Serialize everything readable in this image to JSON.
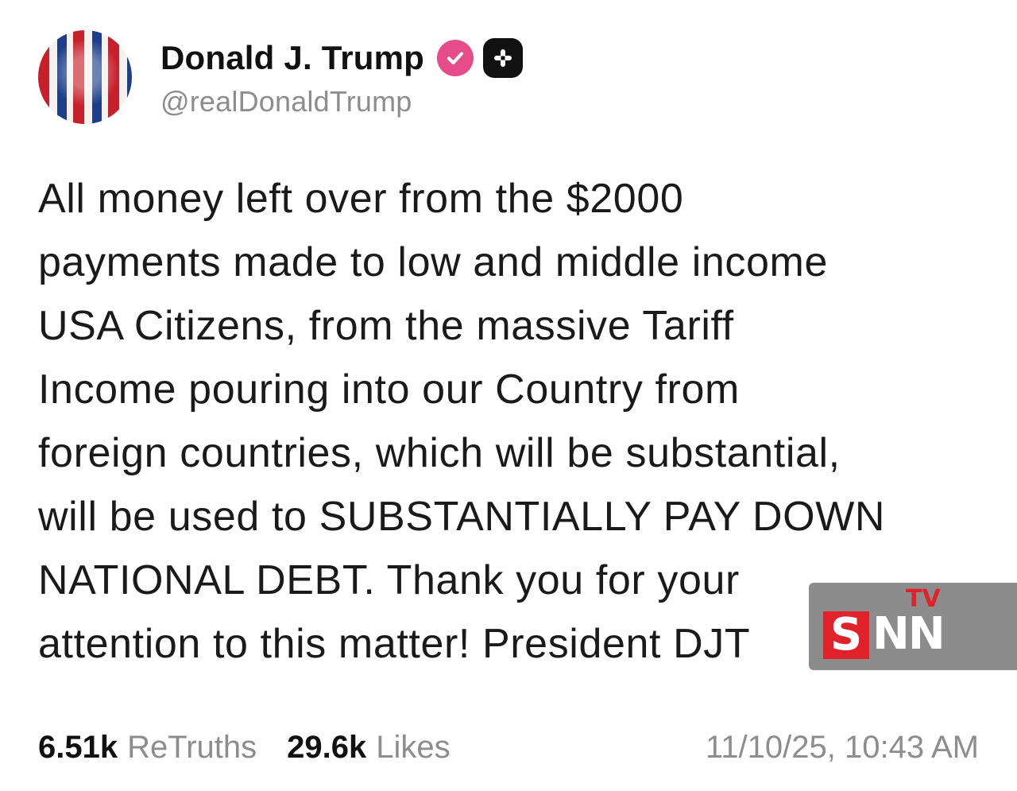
{
  "author": {
    "display_name": "Donald J. Trump",
    "handle": "@realDonaldTrump",
    "verified_icon": "verified-check-icon",
    "badge_icon": "plus-badge-icon",
    "verified_color": "#e64b8a"
  },
  "post": {
    "text": "All money left over from the $2000\npayments made to low and middle income\nUSA Citizens, from the massive Tariff\nIncome pouring into our Country from\nforeign countries, which will be substantial,\nwill be used to SUBSTANTIALLY PAY DOWN\nNATIONAL DEBT. Thank you for your\nattention to this matter! President DJT"
  },
  "stats": {
    "retruths_count": "6.51k",
    "retruths_label": "ReTruths",
    "likes_count": "29.6k",
    "likes_label": "Likes",
    "timestamp": "11/10/25, 10:43 AM"
  },
  "watermark": {
    "s": "S",
    "nn": "NN",
    "tv": "TV"
  }
}
